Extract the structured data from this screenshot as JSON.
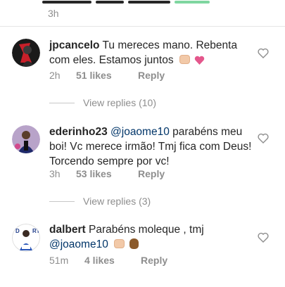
{
  "top_time": "3h",
  "colors": {
    "mention": "#003569",
    "meta": "#8e8e8e",
    "text": "#262626",
    "heart_emoji": "#e4578c"
  },
  "comments": [
    {
      "username": "jpcancelo",
      "text": "Tu mereces mano. Rebenta com eles. Estamos juntos",
      "emojis": [
        "fist-icon",
        "pink-heart-icon"
      ],
      "time": "2h",
      "likes": "51 likes",
      "reply": "Reply",
      "view_replies": "View replies (10)"
    },
    {
      "username": "ederinho23",
      "mention": "@joaome10",
      "text": "parabéns meu boi! Vc merece irmão! Tmj fica com Deus! Torcendo sempre por vc!",
      "time": "3h",
      "likes": "53 likes",
      "reply": "Reply",
      "view_replies": "View replies (3)"
    },
    {
      "username": "dalbert",
      "text": "Parabéns moleque , tmj",
      "mention": "@joaome10",
      "emojis": [
        "fist-icon",
        "ok-hand-icon"
      ],
      "time": "51m",
      "likes": "4 likes",
      "reply": "Reply"
    }
  ]
}
